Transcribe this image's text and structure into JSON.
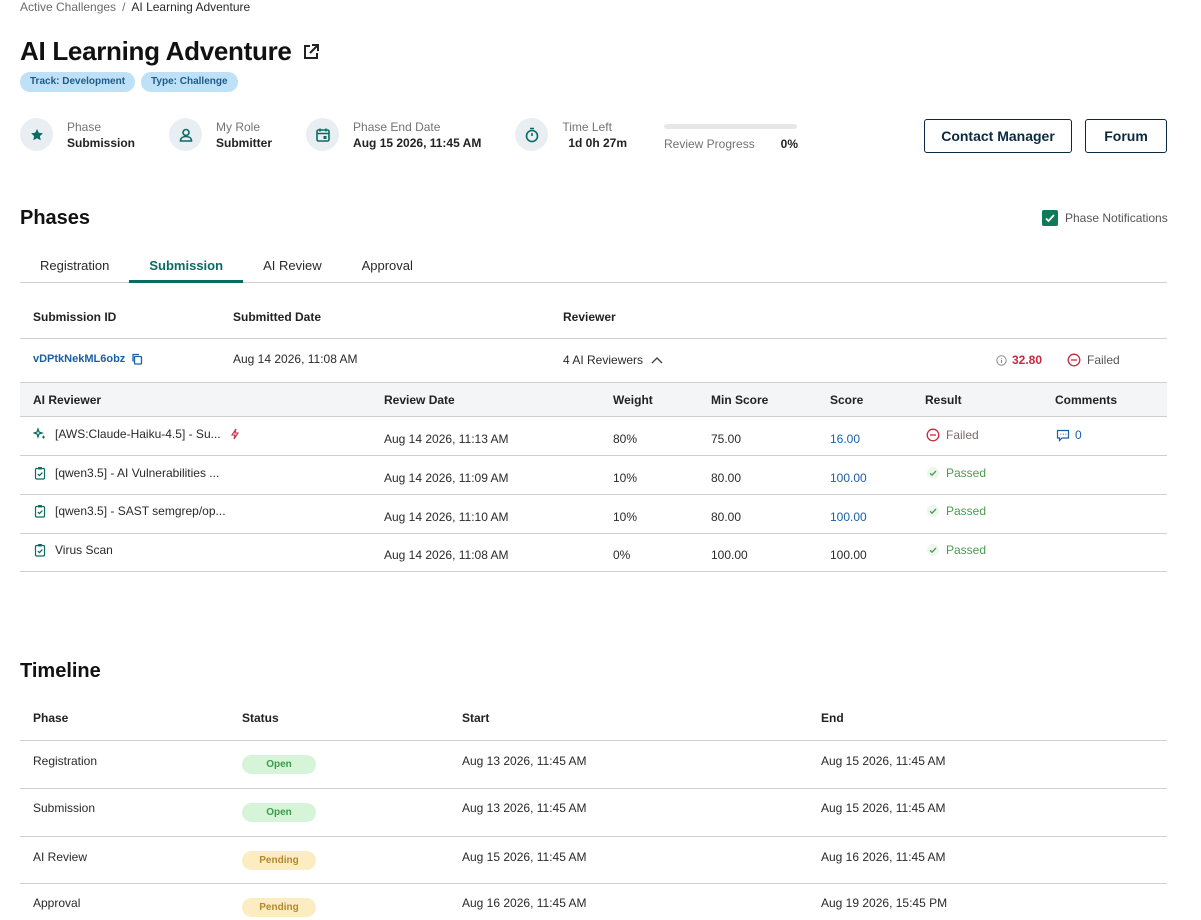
{
  "breadcrumb": {
    "parent": "Active Challenges",
    "separator": "/",
    "current": "AI Learning Adventure"
  },
  "page": {
    "title": "AI Learning Adventure"
  },
  "tags": [
    "Track: Development",
    "Type: Challenge"
  ],
  "stats": {
    "phase": {
      "label": "Phase",
      "value": "Submission"
    },
    "role": {
      "label": "My Role",
      "value": "Submitter"
    },
    "end_date": {
      "label": "Phase End Date",
      "value": "Aug 15 2026, 11:45 AM"
    },
    "time_left": {
      "label": "Time Left",
      "value": "1d 0h 27m"
    },
    "review_progress": {
      "label": "Review Progress",
      "value": "0%",
      "fraction": 0
    }
  },
  "buttons": {
    "contact": "Contact Manager",
    "forum": "Forum"
  },
  "phases": {
    "title": "Phases",
    "notifications_label": "Phase Notifications",
    "tabs": [
      "Registration",
      "Submission",
      "AI Review",
      "Approval"
    ],
    "active_tab": "Submission"
  },
  "submission_table": {
    "headers": {
      "id": "Submission ID",
      "date": "Submitted Date",
      "reviewer": "Reviewer"
    },
    "row": {
      "id": "vDPtkNekML6obz",
      "date": "Aug 14 2026, 11:08 AM",
      "reviewers": "4 AI Reviewers",
      "score": "32.80",
      "result": "Failed"
    }
  },
  "ai_table": {
    "headers": {
      "reviewer": "AI Reviewer",
      "date": "Review Date",
      "weight": "Weight",
      "min_score": "Min Score",
      "score": "Score",
      "result": "Result",
      "comments": "Comments"
    },
    "rows": [
      {
        "name": "[AWS:Claude-Haiku-4.5] - Su...",
        "date": "Aug 14 2026, 11:13 AM",
        "weight": "80%",
        "min": "75.00",
        "score": "16.00",
        "result": "Failed",
        "comments": "0"
      },
      {
        "name": "[qwen3.5] - AI Vulnerabilities ...",
        "date": "Aug 14 2026, 11:09 AM",
        "weight": "10%",
        "min": "80.00",
        "score": "100.00",
        "result": "Passed"
      },
      {
        "name": "[qwen3.5] - SAST semgrep/op...",
        "date": "Aug 14 2026, 11:10 AM",
        "weight": "10%",
        "min": "80.00",
        "score": "100.00",
        "result": "Passed"
      },
      {
        "name": "Virus Scan",
        "date": "Aug 14 2026, 11:08 AM",
        "weight": "0%",
        "min": "100.00",
        "score": "100.00",
        "result": "Passed"
      }
    ]
  },
  "timeline": {
    "title": "Timeline",
    "headers": {
      "phase": "Phase",
      "status": "Status",
      "start": "Start",
      "end": "End"
    },
    "rows": [
      {
        "phase": "Registration",
        "status": "Open",
        "start": "Aug 13 2026, 11:45 AM",
        "end": "Aug 15 2026, 11:45 AM"
      },
      {
        "phase": "Submission",
        "status": "Open",
        "start": "Aug 13 2026, 11:45 AM",
        "end": "Aug 15 2026, 11:45 AM"
      },
      {
        "phase": "AI Review",
        "status": "Pending",
        "start": "Aug 15 2026, 11:45 AM",
        "end": "Aug 16 2026, 11:45 AM"
      },
      {
        "phase": "Approval",
        "status": "Pending",
        "start": "Aug 16 2026, 11:45 AM",
        "end": "Aug 19 2026, 15:45 PM"
      }
    ]
  },
  "colors": {
    "accent": "#0a6b63",
    "link": "#1b5fa8",
    "danger": "#c9283f",
    "success": "#4a9a50"
  }
}
